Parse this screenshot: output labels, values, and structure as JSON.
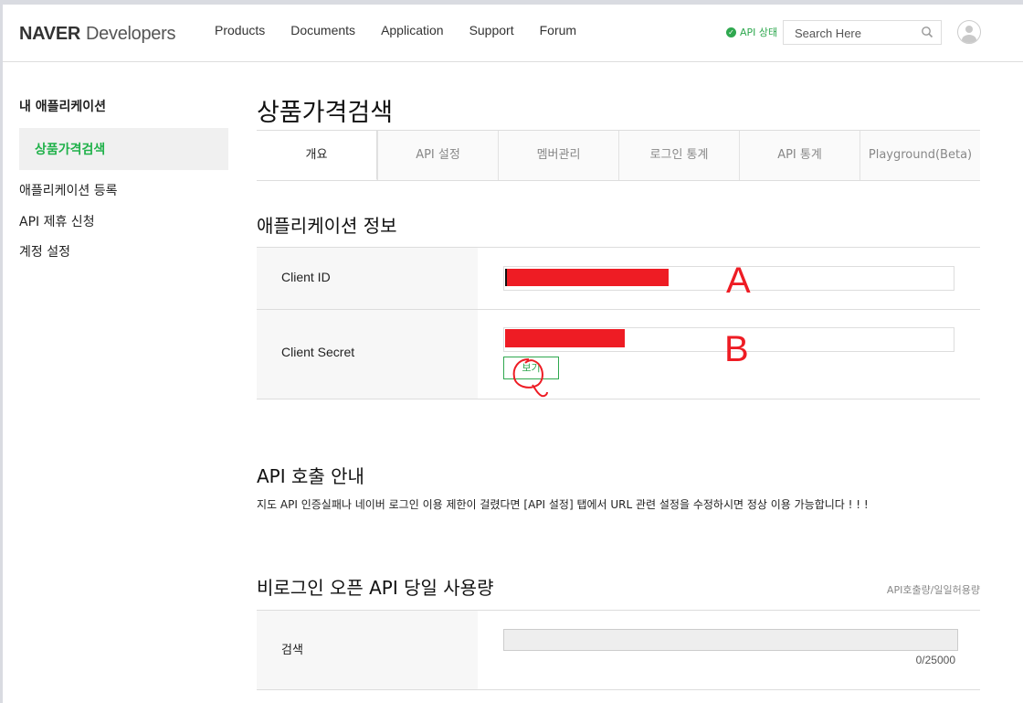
{
  "header": {
    "logo_brand": "NAVER",
    "logo_product": "Developers",
    "nav": [
      "Products",
      "Documents",
      "Application",
      "Support",
      "Forum"
    ],
    "api_status": "API 상태",
    "search_placeholder": "Search Here"
  },
  "sidebar": {
    "title": "내 애플리케이션",
    "active_item": "상품가격검색",
    "items": [
      "애플리케이션 등록",
      "API 제휴 신청",
      "계정 설정"
    ]
  },
  "main": {
    "title": "상품가격검색",
    "tabs": [
      "개요",
      "API 설정",
      "멤버관리",
      "로그인 통계",
      "API 통계",
      "Playground(Beta)"
    ],
    "active_tab": 0,
    "app_info": {
      "heading": "애플리케이션 정보",
      "client_id_label": "Client ID",
      "client_secret_label": "Client Secret",
      "view_button": "보기"
    },
    "annotations": {
      "a": "A",
      "b": "B"
    },
    "api_call": {
      "heading": "API 호출 안내",
      "text": "지도 API 인증실패나 네이버 로그인 이용 제한이 걸렸다면 [API 설정] 탭에서 URL 관련 설정을 수정하시면 정상 이용 가능합니다 ! ! !"
    },
    "usage": {
      "heading": "비로그인 오픈 API 당일 사용량",
      "hint": "API호출량/일일허용량",
      "rows": [
        {
          "label": "검색",
          "count": "0/25000",
          "used": 0,
          "limit": 25000
        }
      ]
    }
  },
  "colors": {
    "accent": "#2fa84f",
    "annotation_red": "#ee1c24"
  }
}
